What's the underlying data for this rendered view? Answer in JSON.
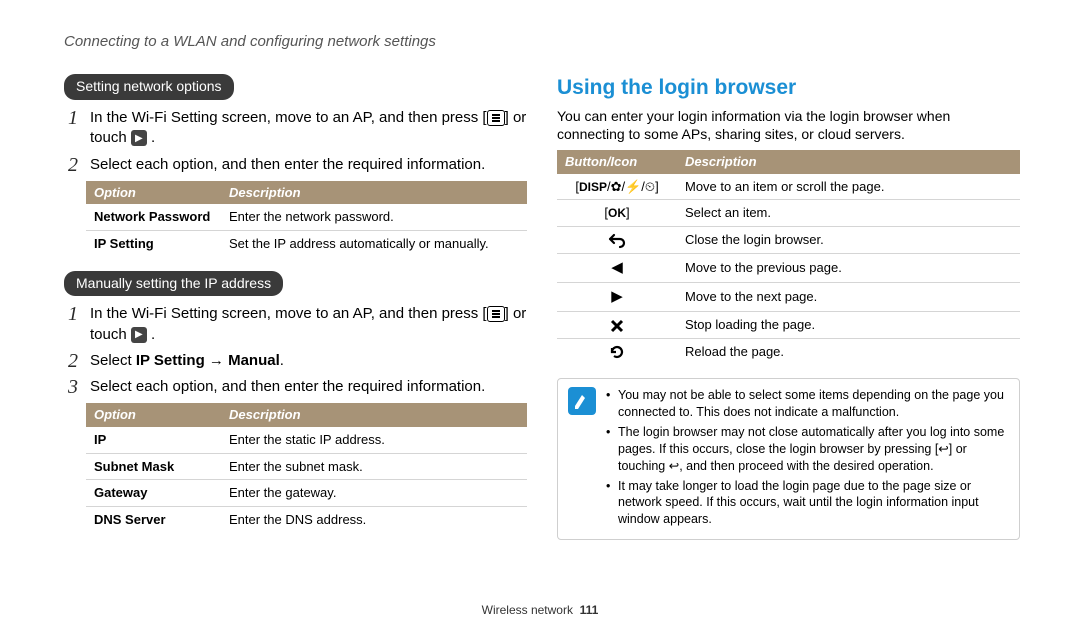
{
  "header": "Connecting to a WLAN and configuring network settings",
  "left": {
    "pill1": "Setting network options",
    "steps1": [
      {
        "pre": "In the Wi-Fi Setting screen, move to an AP, and then press [",
        "mid": "] or touch ",
        "post": " ."
      },
      {
        "pre": "Select each option, and then enter the required information."
      }
    ],
    "table1_h1": "Option",
    "table1_h2": "Description",
    "table1": [
      {
        "o": "Network Password",
        "d": "Enter the network password."
      },
      {
        "o": "IP Setting",
        "d": "Set the IP address automatically or manually."
      }
    ],
    "pill2": "Manually setting the IP address",
    "steps2": [
      {
        "pre": "In the Wi-Fi Setting screen, move to an AP, and then press [",
        "mid": "] or touch ",
        "post": " ."
      },
      {
        "pre": "Select ",
        "b": "IP Setting → Manual",
        "post": "."
      },
      {
        "pre": "Select each option, and then enter the required information."
      }
    ],
    "table2_h1": "Option",
    "table2_h2": "Description",
    "table2": [
      {
        "o": "IP",
        "d": "Enter the static IP address."
      },
      {
        "o": "Subnet Mask",
        "d": "Enter the subnet mask."
      },
      {
        "o": "Gateway",
        "d": "Enter the gateway."
      },
      {
        "o": "DNS Server",
        "d": "Enter the DNS address."
      }
    ]
  },
  "right": {
    "title": "Using the login browser",
    "intro": "You can enter your login information via the login browser when connecting to some APs, sharing sites, or cloud servers.",
    "table_h1": "Button/Icon",
    "table_h2": "Description",
    "rows": [
      {
        "d": "Move to an item or scroll the page."
      },
      {
        "d": "Select an item."
      },
      {
        "d": "Close the login browser."
      },
      {
        "d": "Move to the previous page."
      },
      {
        "d": "Move to the next page."
      },
      {
        "d": "Stop loading the page."
      },
      {
        "d": "Reload the page."
      }
    ],
    "notes": [
      "You may not be able to select some items depending on the page you connected to. This does not indicate a malfunction.",
      "The login browser may not close automatically after you log into some pages. If this occurs, close the login browser by pressing [↩] or touching ↩, and then proceed with the desired operation.",
      "It may take longer to load the login page due to the page size or network speed. If this occurs, wait until the login information input window appears."
    ]
  },
  "footer_label": "Wireless network",
  "footer_page": "111",
  "icons": {
    "menu": "menu-icon",
    "chevron": "chevron-right-icon",
    "disp": "DISP",
    "ok": "OK",
    "back": "back-icon",
    "prev": "triangle-left-icon",
    "next": "triangle-right-icon",
    "stop": "close-icon",
    "reload": "reload-icon",
    "macro": "flower-icon",
    "flash": "flash-icon",
    "timer": "timer-icon",
    "note": "note-icon"
  }
}
